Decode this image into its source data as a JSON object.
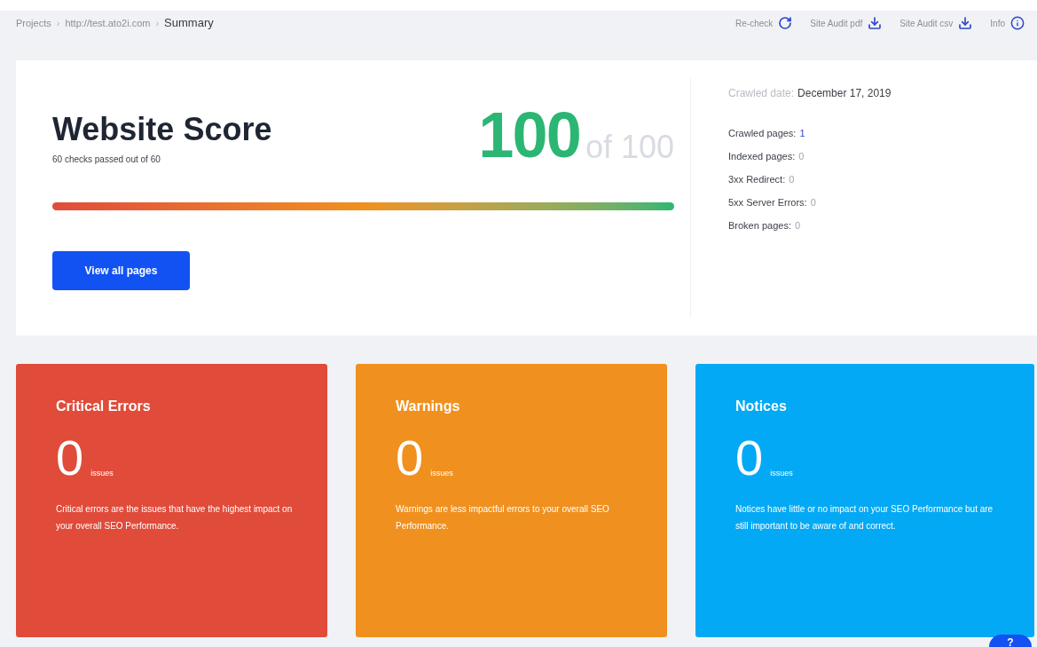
{
  "breadcrumb": [
    {
      "label": "Projects",
      "current": false
    },
    {
      "label": "http://test.ato2i.com",
      "current": false
    },
    {
      "label": "Summary",
      "current": true
    }
  ],
  "separator": "›",
  "actions": [
    {
      "label": "Re-check",
      "kind": "recheck"
    },
    {
      "label": "Site Audit pdf",
      "kind": "download"
    },
    {
      "label": "Site Audit csv",
      "kind": "download"
    },
    {
      "label": "Info",
      "kind": "info"
    }
  ],
  "score": {
    "title": "Website Score",
    "subtitle": "60 checks passed out of 60",
    "value": "100",
    "out_of": "of 100",
    "button": "View all pages"
  },
  "crawl": {
    "date_label": "Crawled date:",
    "date": "December 17, 2019",
    "stats": [
      {
        "label": "Crawled pages:",
        "value": "1",
        "linked": true
      },
      {
        "label": "Indexed pages:",
        "value": "0",
        "linked": false
      },
      {
        "label": "3xx Redirect:",
        "value": "0",
        "linked": false
      },
      {
        "label": "5xx Server Errors:",
        "value": "0",
        "linked": false
      },
      {
        "label": "Broken pages:",
        "value": "0",
        "linked": false
      }
    ]
  },
  "cards": [
    {
      "title": "Critical Errors",
      "count": "0",
      "unit": "issues",
      "text": "Critical errors are the issues that have the highest impact on your overall SEO Performance.",
      "color": "#e04b3a"
    },
    {
      "title": "Warnings",
      "count": "0",
      "unit": "issues",
      "text": "Warnings are less impactful errors to your overall SEO Performance.",
      "color": "#f0901e"
    },
    {
      "title": "Notices",
      "count": "0",
      "unit": "issues",
      "text": "Notices have little or no impact on your SEO Performance but are still important to be aware of and correct.",
      "color": "#03a9f4"
    }
  ],
  "help": "?"
}
